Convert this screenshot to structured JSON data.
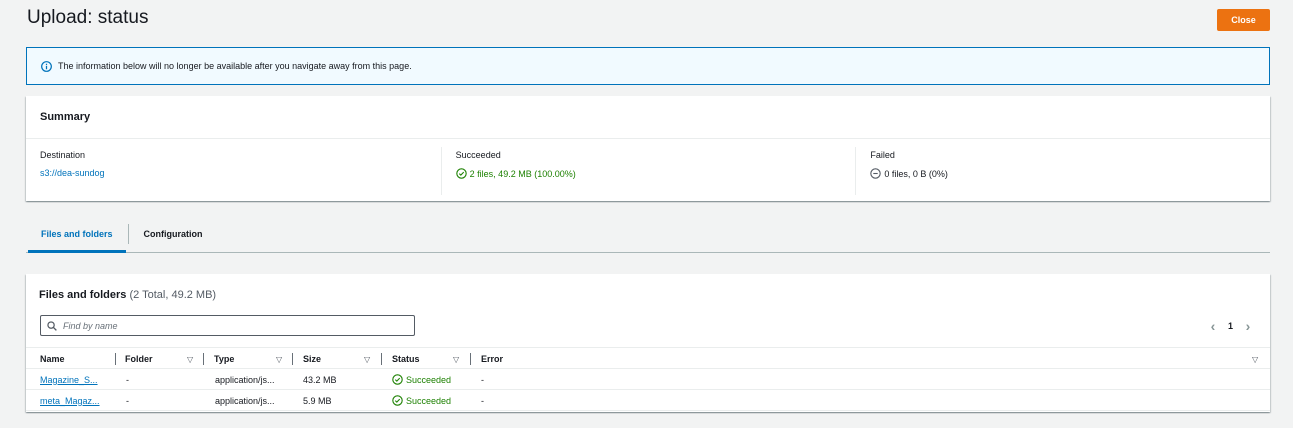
{
  "header": {
    "title": "Upload: status",
    "close_label": "Close"
  },
  "alert": {
    "icon": "info-icon",
    "text": "The information below will no longer be available after you navigate away from this page."
  },
  "summary": {
    "title": "Summary",
    "destination": {
      "label": "Destination",
      "value": "s3://dea-sundog"
    },
    "succeeded": {
      "label": "Succeeded",
      "value": "2 files, 49.2 MB (100.00%)"
    },
    "failed": {
      "label": "Failed",
      "value": "0 files, 0 B (0%)"
    }
  },
  "tabs": [
    {
      "label": "Files and folders",
      "active": true
    },
    {
      "label": "Configuration",
      "active": false
    }
  ],
  "files": {
    "title": "Files and folders",
    "count": "(2 Total, 49.2 MB)",
    "search_placeholder": "Find by name",
    "page": "1",
    "columns": [
      "Name",
      "Folder",
      "Type",
      "Size",
      "Status",
      "Error"
    ],
    "rows": [
      {
        "name": "Magazine_S...",
        "folder": "-",
        "type": "application/js...",
        "size": "43.2 MB",
        "status": "Succeeded",
        "error": "-"
      },
      {
        "name": "meta_Magaz...",
        "folder": "-",
        "type": "application/js...",
        "size": "5.9 MB",
        "status": "Succeeded",
        "error": "-"
      }
    ]
  },
  "colors": {
    "accent": "#0073bb",
    "primary_button": "#ec7211",
    "success": "#1d8102"
  }
}
